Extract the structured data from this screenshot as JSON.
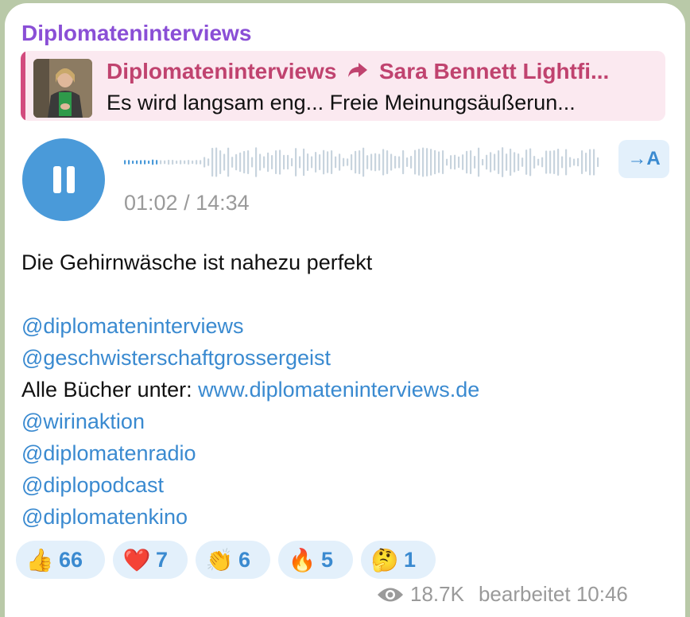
{
  "channel_name": "Diplomateninterviews",
  "reply": {
    "source": "Diplomateninterviews",
    "forward_icon": "forward-arrow-icon",
    "forwarded_from": "Sara Bennett Lightfi...",
    "preview_text": "Es wird langsam eng...  Freie Meinungsäußerun..."
  },
  "audio": {
    "state_icon": "pause-icon",
    "time": "01:02 / 14:34",
    "transcribe_label": "→A",
    "progress_fraction": 0.071
  },
  "message": {
    "line1": "Die Gehirnwäsche ist nahezu perfekt",
    "link1": "@diplomateninterviews",
    "link2": "@geschwisterschaftgrossergeist",
    "books_prefix": "Alle Bücher unter: ",
    "books_link": "www.diplomateninterviews.de",
    "link3": "@wirinaktion",
    "link4": "@diplomatenradio",
    "link5": "@diplopodcast",
    "link6": "@diplomatenkino"
  },
  "reactions": [
    {
      "emoji": "👍",
      "count": "66"
    },
    {
      "emoji": "❤️",
      "count": "7"
    },
    {
      "emoji": "👏",
      "count": "6"
    },
    {
      "emoji": "🔥",
      "count": "5"
    },
    {
      "emoji": "🤔",
      "count": "1"
    }
  ],
  "meta": {
    "views_icon": "eye-icon",
    "views": "18.7K",
    "edited_time": "bearbeitet 10:46"
  },
  "colors": {
    "channel": "#8a4fd6",
    "reply_accent": "#d24b7e",
    "link": "#3a8ad0",
    "play_button": "#4a9ad9"
  }
}
